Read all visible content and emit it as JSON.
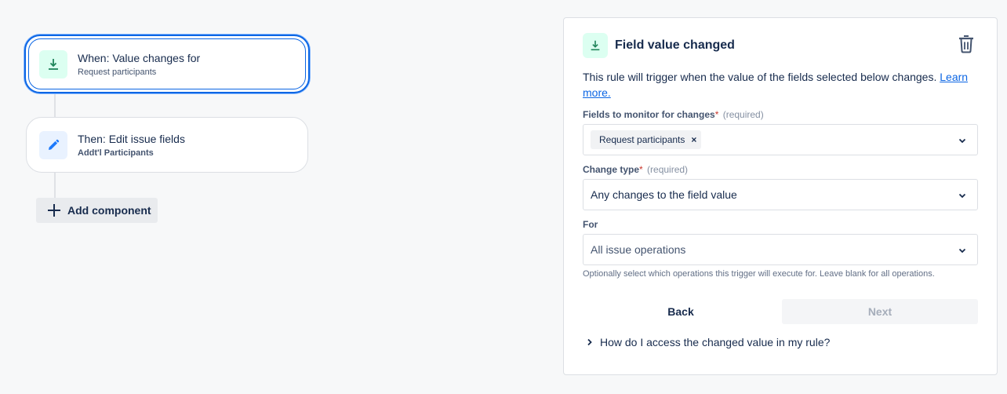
{
  "canvas": {
    "trigger_card": {
      "title": "When: Value changes for",
      "subtitle": "Request participants",
      "icon": "field-value-changed-icon"
    },
    "action_card": {
      "title": "Then: Edit issue fields",
      "subtitle": "Addt'l Participants",
      "icon": "pencil-icon"
    },
    "add_component_label": "Add component"
  },
  "panel": {
    "title": "Field value changed",
    "description": "This rule will trigger when the value of the fields selected below changes.",
    "learn_more": "Learn more.",
    "fields_label": "Fields to monitor for changes",
    "required_text": "(required)",
    "required_star": "*",
    "selected_field_tag": "Request participants",
    "tag_remove": "×",
    "change_type_label": "Change type",
    "change_type_value": "Any changes to the field value",
    "for_label": "For",
    "for_placeholder": "All issue operations",
    "helper_text": "Optionally select which operations this trigger will execute for. Leave blank for all operations.",
    "back_label": "Back",
    "next_label": "Next",
    "faq_label": "How do I access the changed value in my rule?"
  },
  "colors": {
    "accent": "#0c66e4",
    "trigger_icon_bg": "#dcfff1",
    "trigger_icon_fg": "#1f845a",
    "action_icon_bg": "#e9f2ff",
    "action_icon_fg": "#1d7afc",
    "required_star": "#c9372c"
  }
}
